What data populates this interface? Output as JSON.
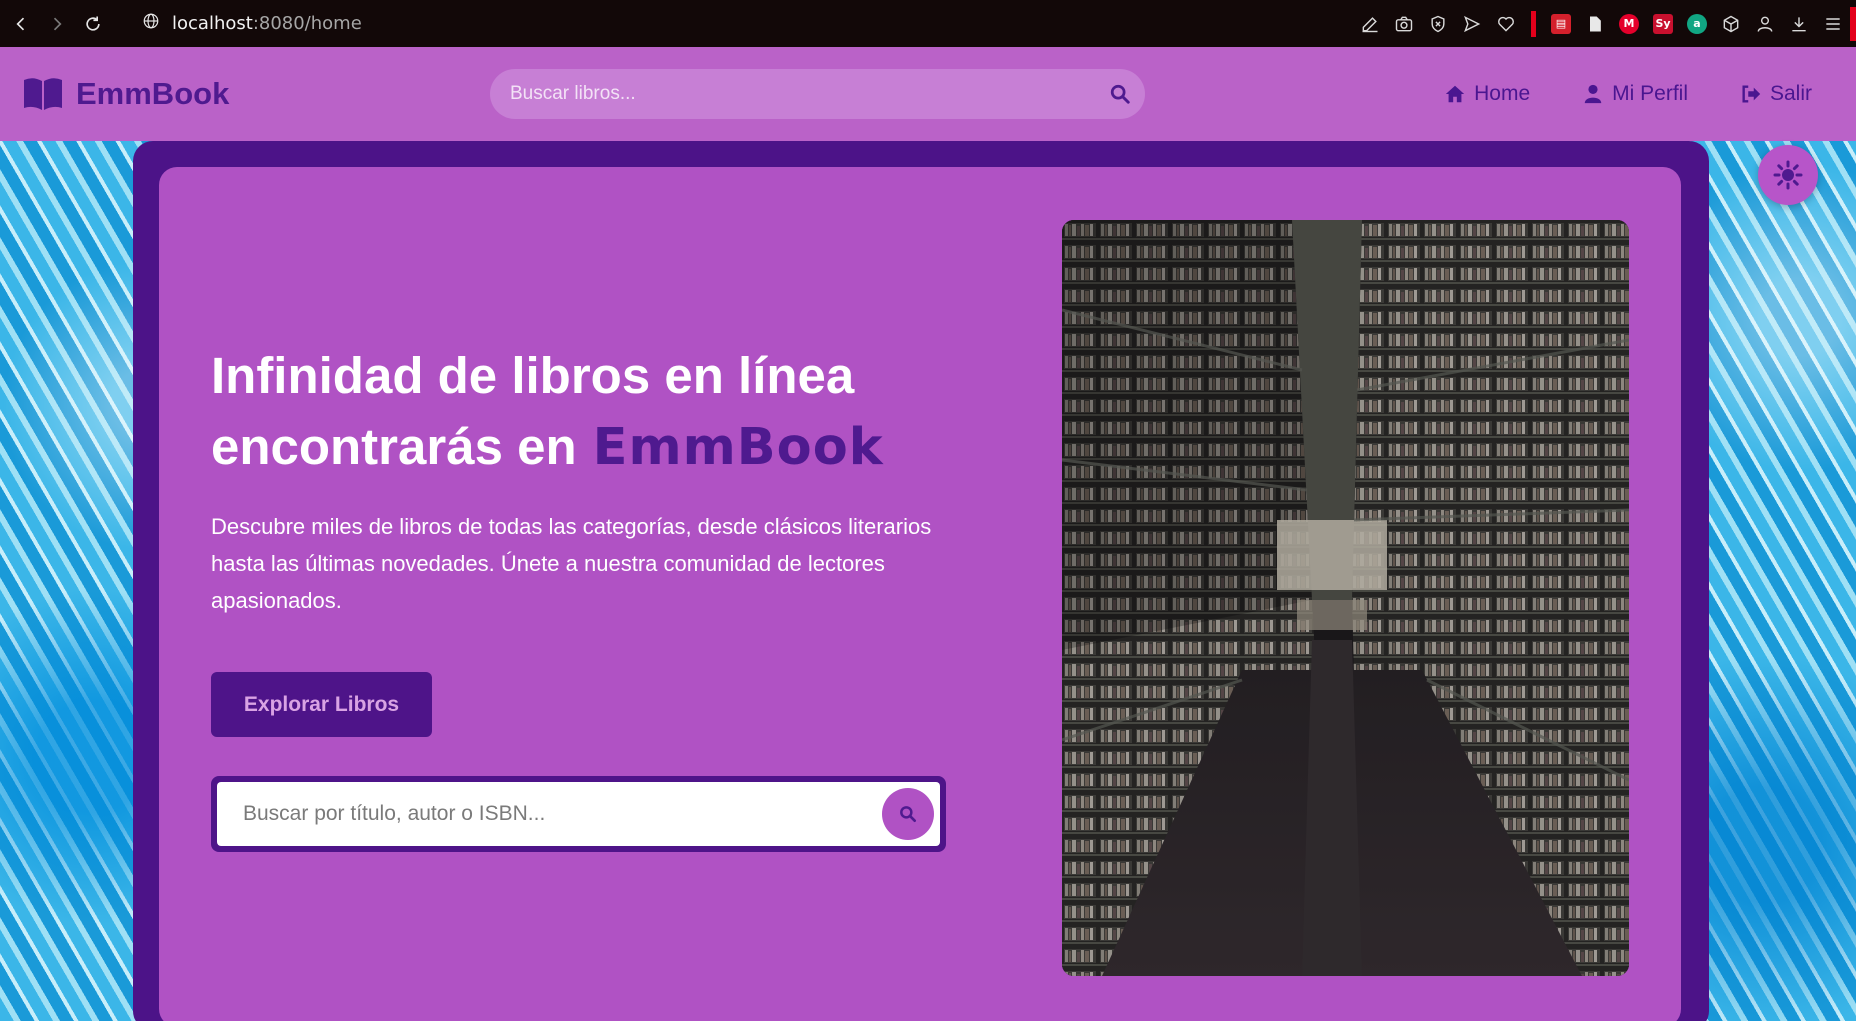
{
  "browser": {
    "url_host": "localhost",
    "url_rest": ":8080/home",
    "icons": [
      "back-icon",
      "forward-icon",
      "reload-icon",
      "globe-icon"
    ],
    "extensions": [
      "edit-icon",
      "camera-icon",
      "shield-x-icon",
      "send-icon",
      "heart-icon",
      "m-ext-icon",
      "doc-icon",
      "mail-m-icon",
      "sy-ext-icon",
      "a-ext-icon",
      "cube-icon",
      "profile-icon",
      "download-icon",
      "menu-icon"
    ],
    "ext_badges": {
      "sy": "Sy",
      "a": "a",
      "m": "M"
    }
  },
  "navbar": {
    "brand": "EmmBook",
    "search_placeholder": "Buscar libros...",
    "links": [
      {
        "label": "Home",
        "icon": "home-icon"
      },
      {
        "label": "Mi Perfil",
        "icon": "user-icon"
      },
      {
        "label": "Salir",
        "icon": "logout-icon"
      }
    ]
  },
  "hero": {
    "title_line1": "Infinidad de libros en línea",
    "title_line2": "encontrarás en",
    "title_accent": "EmmBook",
    "description": "Descubre miles de libros de todas las categorías, desde clásicos literarios hasta las últimas novedades. Únete a nuestra comunidad de lectores apasionados.",
    "cta_label": "Explorar Libros",
    "search_placeholder": "Buscar por título, autor o ISBN..."
  },
  "colors": {
    "navbar_bg": "#ba62c8",
    "brand_purple": "#4f1a8f",
    "hero_bg": "#b052c4",
    "frame": "#4c1388"
  }
}
